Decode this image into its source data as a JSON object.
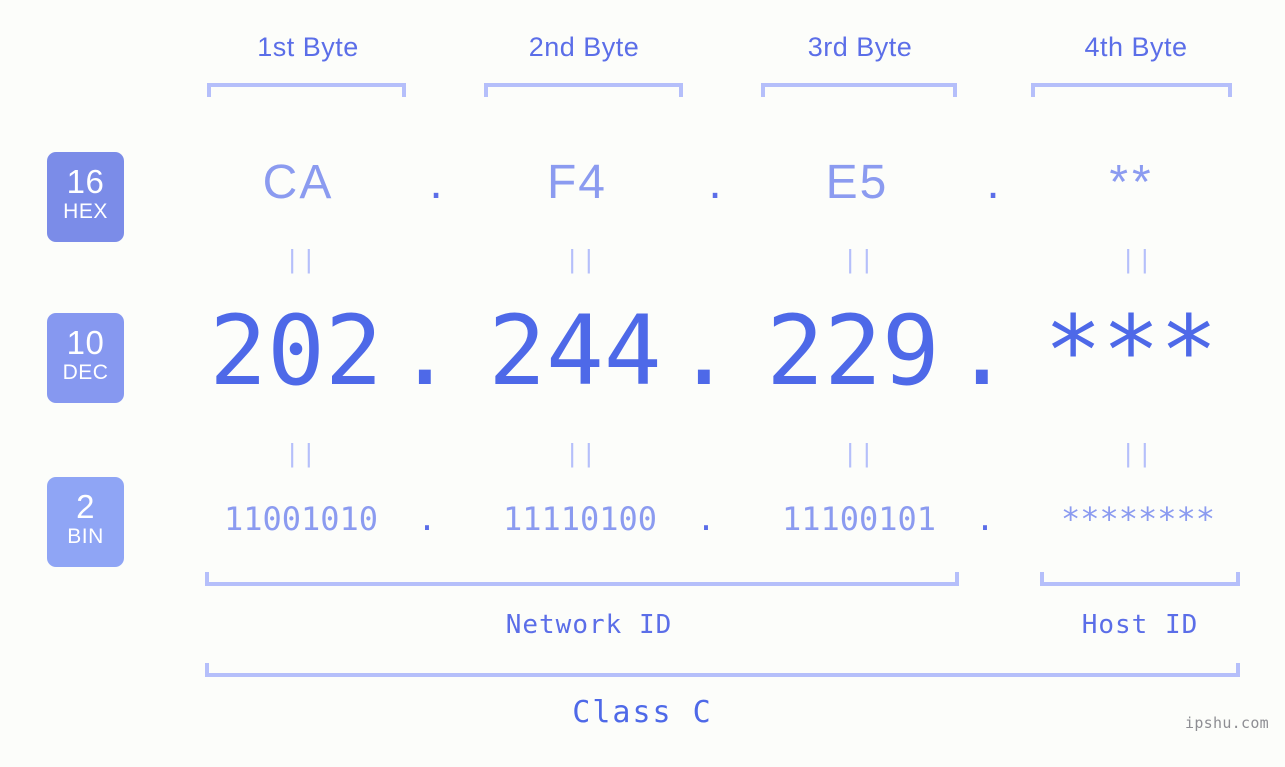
{
  "background_color": "#fcfdfa",
  "accent_colors": {
    "strong_blue": "#4e69e8",
    "medium_blue": "#5b6ee8",
    "light_blue": "#8b9bf0",
    "pale_blue": "#b5bffa",
    "badge_hex": "#7b8ce8",
    "badge_dec": "#8698f0",
    "badge_bin": "#8fa5f5",
    "watermark_gray": "#8e8e93"
  },
  "byte_headers": [
    {
      "label": "1st Byte"
    },
    {
      "label": "2nd Byte"
    },
    {
      "label": "3rd Byte"
    },
    {
      "label": "4th Byte"
    }
  ],
  "rows": {
    "hex": {
      "badge_number": "16",
      "badge_name": "HEX",
      "values": [
        "CA",
        "F4",
        "E5",
        "**"
      ],
      "separators": [
        ".",
        ".",
        "."
      ]
    },
    "dec": {
      "badge_number": "10",
      "badge_name": "DEC",
      "values": [
        "202",
        "244",
        "229",
        "***"
      ],
      "separators": [
        ".",
        ".",
        "."
      ]
    },
    "bin": {
      "badge_number": "2",
      "badge_name": "BIN",
      "values": [
        "11001010",
        "11110100",
        "11100101",
        "********"
      ],
      "separators": [
        ".",
        ".",
        "."
      ]
    }
  },
  "equals_marks": {
    "glyph": "||",
    "hex_to_dec_count": 4,
    "dec_to_bin_count": 4
  },
  "id_labels": {
    "network": "Network ID",
    "host": "Host ID"
  },
  "class_label": "Class C",
  "watermark": "ipshu.com"
}
